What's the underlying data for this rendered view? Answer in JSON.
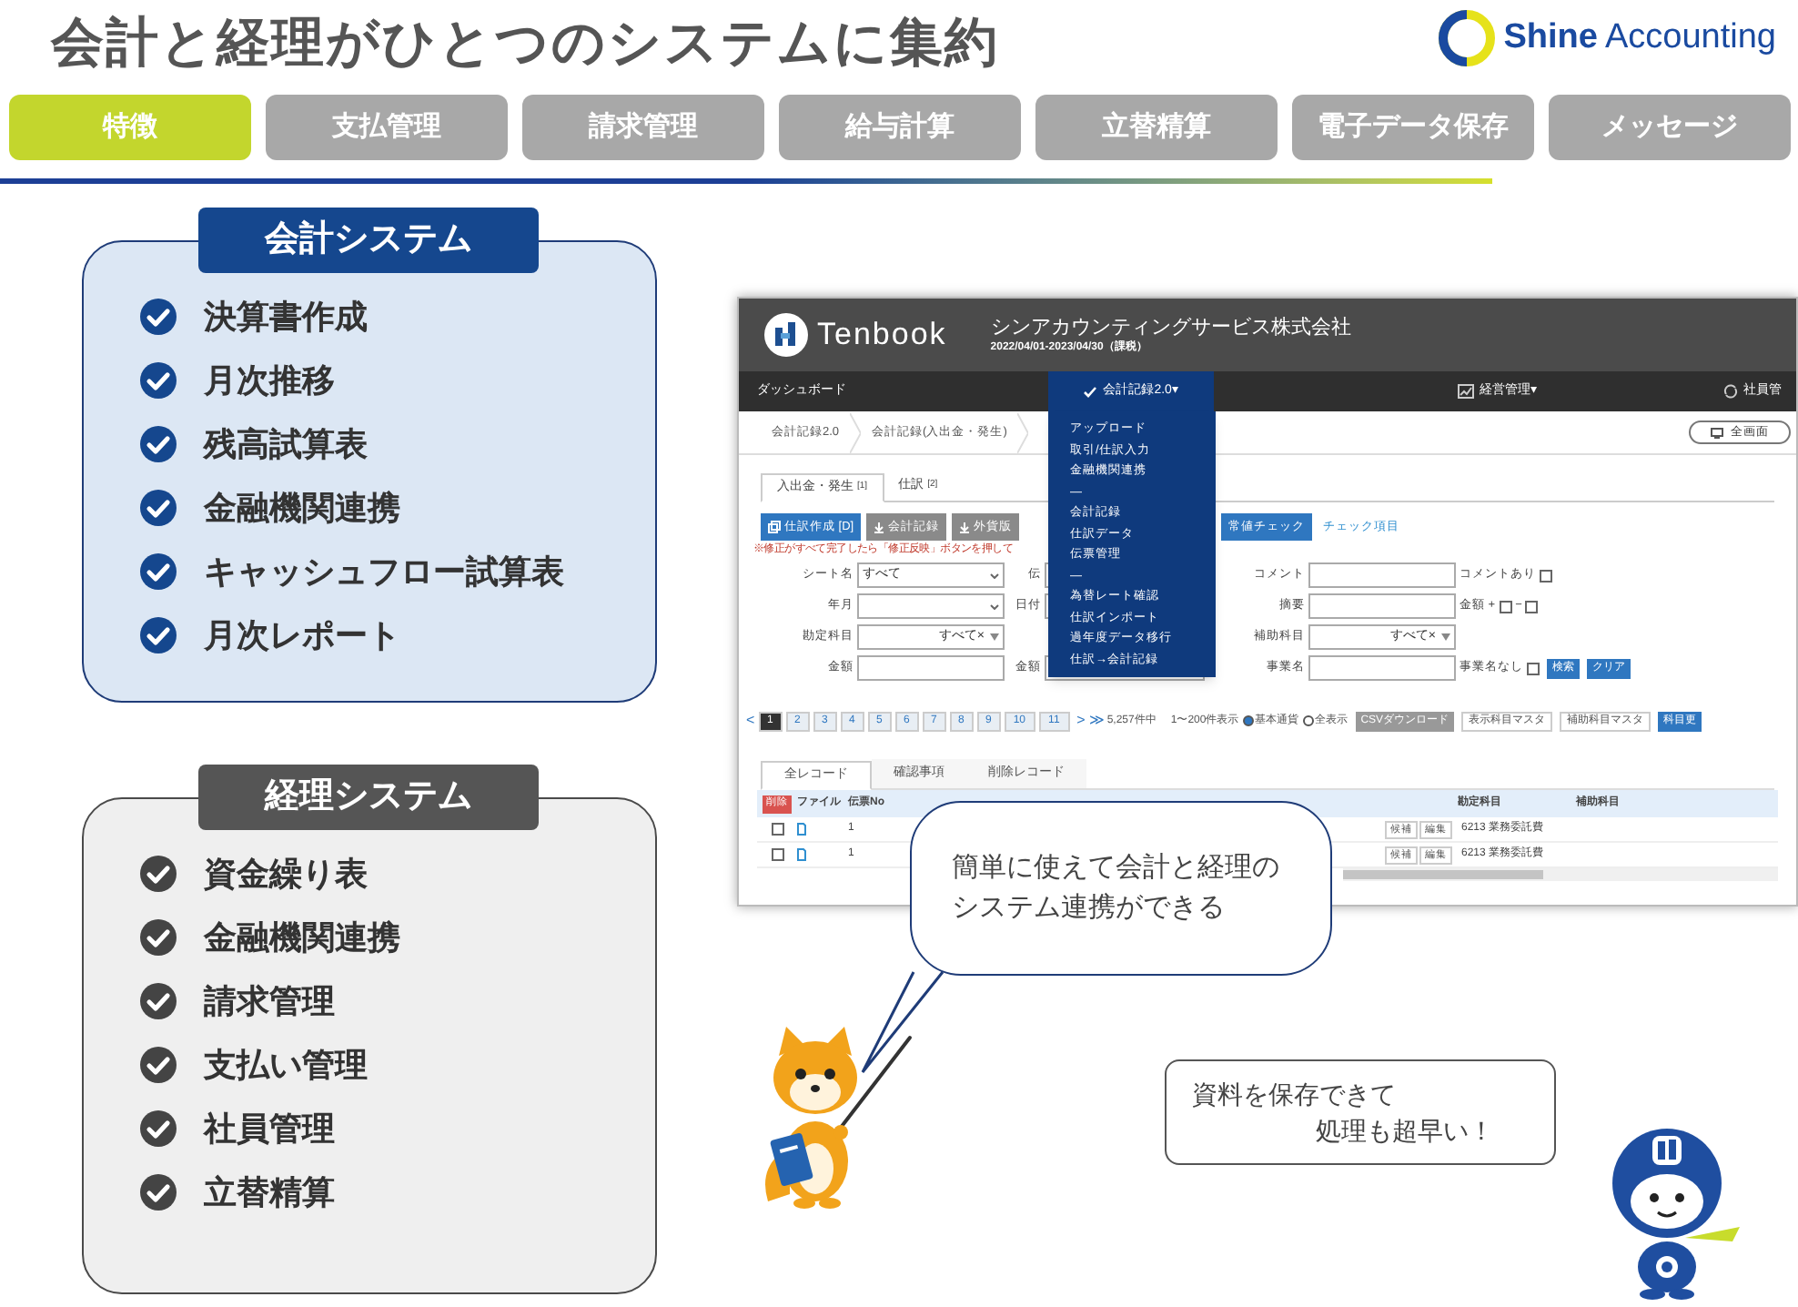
{
  "title": "会計と経理がひとつのシステムに集約",
  "logo": {
    "brand": "Shine",
    "product": "Accounting"
  },
  "tabs": [
    {
      "label": "特徴",
      "selected": true
    },
    {
      "label": "支払管理",
      "selected": false
    },
    {
      "label": "請求管理",
      "selected": false
    },
    {
      "label": "給与計算",
      "selected": false
    },
    {
      "label": "立替精算",
      "selected": false
    },
    {
      "label": "電子データ保存",
      "selected": false
    },
    {
      "label": "メッセージ",
      "selected": false
    }
  ],
  "panels": [
    {
      "title": "会計システム",
      "kind": "blue",
      "items": [
        "決算書作成",
        "月次推移",
        "残高試算表",
        "金融機関連携",
        "キャッシュフロー試算表",
        "月次レポート"
      ]
    },
    {
      "title": "経理システム",
      "kind": "gray",
      "items": [
        "資金繰り表",
        "金融機関連携",
        "請求管理",
        "支払い管理",
        "社員管理",
        "立替精算"
      ]
    }
  ],
  "app": {
    "logo_text": "Tenbook",
    "company": "シンアカウンティングサービス株式会社",
    "period": "2022/04/01-2023/04/30（課税）",
    "nav": [
      {
        "label": "ダッシュボード",
        "selected": false
      },
      {
        "label": "会計記録2.0▾",
        "selected": true
      },
      {
        "label": "経営管理▾",
        "selected": false
      },
      {
        "label": "社員管",
        "selected": false
      }
    ],
    "breadcrumb": [
      "会計記録2.0",
      "会計記録(入出金・発生)"
    ],
    "fullscreen_button": "全画面",
    "menu": [
      "アップロード",
      "取引/仕訳入力",
      "金融機関連携",
      "—",
      "会計記録",
      "仕訳データ",
      "伝票管理",
      "—",
      "為替レート確認",
      "仕訳インポート",
      "過年度データ移行",
      "仕訳→会計記録"
    ],
    "sub_tabs": [
      {
        "label": "入出金・発生",
        "count": "[1]",
        "selected": true
      },
      {
        "label": "仕訳",
        "count": "[2]",
        "selected": false
      }
    ],
    "actions": [
      {
        "label": "仕訳作成 [D]",
        "kind": "primary"
      },
      {
        "label": "会計記録",
        "kind": "gray"
      },
      {
        "label": "外貨版",
        "kind": "gray"
      },
      {
        "label": "常値チェック",
        "kind": "primary"
      }
    ],
    "check_link": "チェック項目",
    "note": "※修正がすべて完了したら「修正反映」ボタンを押して",
    "form": [
      {
        "groups": [
          {
            "label": "シート名",
            "kind": "select",
            "value": "すべて"
          },
          {
            "label": "伝",
            "kind": "input"
          },
          {
            "label": "コメント",
            "kind": "input"
          }
        ],
        "extras": [
          {
            "kind": "text",
            "text": "コメントあり"
          },
          {
            "kind": "checkbox",
            "checked": false
          }
        ]
      },
      {
        "groups": [
          {
            "label": "年月",
            "kind": "select"
          },
          {
            "label": "日付",
            "kind": "input"
          },
          {
            "label": "摘要",
            "kind": "input"
          }
        ],
        "extras": [
          {
            "kind": "text",
            "text": "金額 +"
          },
          {
            "kind": "checkbox",
            "checked": false
          },
          {
            "kind": "text",
            "text": "−"
          },
          {
            "kind": "checkbox",
            "checked": false
          }
        ]
      },
      {
        "groups": [
          {
            "label": "勘定科目",
            "kind": "tag_select",
            "value": "すべて×"
          },
          {
            "kind": "none"
          },
          {
            "label": "補助科目",
            "kind": "tag_select",
            "value": "すべて×"
          }
        ]
      },
      {
        "groups": [
          {
            "label": "金額",
            "kind": "input"
          },
          {
            "label": "金額",
            "kind": "input"
          },
          {
            "label": "事業名",
            "kind": "input"
          }
        ],
        "extras": [
          {
            "kind": "text",
            "text": "事業名なし"
          },
          {
            "kind": "checkbox",
            "checked": false
          },
          {
            "kind": "button",
            "text": "検索"
          },
          {
            "kind": "button",
            "text": "クリア"
          }
        ]
      }
    ],
    "pagination": {
      "prev": "<",
      "pages": [
        {
          "label": "1",
          "selected": true
        },
        {
          "label": "2",
          "selected": false
        },
        {
          "label": "3",
          "selected": false
        },
        {
          "label": "4",
          "selected": false
        },
        {
          "label": "5",
          "selected": false
        },
        {
          "label": "6",
          "selected": false
        },
        {
          "label": "7",
          "selected": false
        },
        {
          "label": "8",
          "selected": false
        },
        {
          "label": "9",
          "selected": false
        },
        {
          "label": "10",
          "selected": false
        },
        {
          "label": "11",
          "selected": false
        }
      ],
      "next": ">",
      "last": "≫",
      "total": "5,257件中",
      "range": "1〜200件表示"
    },
    "radios": [
      {
        "label": "基本通貨",
        "selected": true
      },
      {
        "label": "全表示",
        "selected": false
      }
    ],
    "tools": [
      {
        "label": "CSVダウンロード",
        "kind": "gray"
      },
      {
        "label": "表示科目マスタ",
        "kind": "outline"
      },
      {
        "label": "補助科目マスタ",
        "kind": "outline"
      },
      {
        "label": "科目更",
        "kind": "primary"
      }
    ],
    "record_tabs": [
      {
        "label": "全レコード",
        "selected": true
      },
      {
        "label": "確認事項",
        "selected": false
      },
      {
        "label": "削除レコード",
        "selected": false
      }
    ],
    "table": {
      "delete_button": "削除",
      "columns": [
        "ファイル",
        "伝票No",
        "勘定科目",
        "補助科目"
      ],
      "rows": [
        {
          "checked": false,
          "no": "1",
          "buttons": [
            "候補",
            "編集"
          ],
          "account": "6213 業務委託費"
        },
        {
          "checked": false,
          "no": "1",
          "buttons": [
            "候補",
            "編集"
          ],
          "account": "6213 業務委託費"
        }
      ]
    }
  },
  "bubbles": [
    {
      "lines": [
        "簡単に使えて会計と経理の",
        "システム連携ができる"
      ]
    },
    {
      "lines": [
        "資料を保存できて",
        "処理も超早い！"
      ]
    }
  ]
}
